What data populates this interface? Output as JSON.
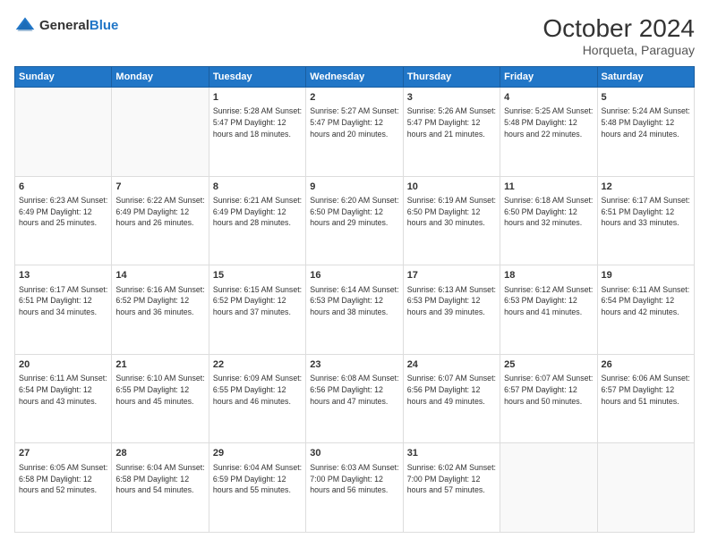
{
  "header": {
    "logo_general": "General",
    "logo_blue": "Blue",
    "month_year": "October 2024",
    "location": "Horqueta, Paraguay"
  },
  "days_of_week": [
    "Sunday",
    "Monday",
    "Tuesday",
    "Wednesday",
    "Thursday",
    "Friday",
    "Saturday"
  ],
  "weeks": [
    [
      {
        "day": "",
        "info": ""
      },
      {
        "day": "",
        "info": ""
      },
      {
        "day": "1",
        "info": "Sunrise: 5:28 AM\nSunset: 5:47 PM\nDaylight: 12 hours and 18 minutes."
      },
      {
        "day": "2",
        "info": "Sunrise: 5:27 AM\nSunset: 5:47 PM\nDaylight: 12 hours and 20 minutes."
      },
      {
        "day": "3",
        "info": "Sunrise: 5:26 AM\nSunset: 5:47 PM\nDaylight: 12 hours and 21 minutes."
      },
      {
        "day": "4",
        "info": "Sunrise: 5:25 AM\nSunset: 5:48 PM\nDaylight: 12 hours and 22 minutes."
      },
      {
        "day": "5",
        "info": "Sunrise: 5:24 AM\nSunset: 5:48 PM\nDaylight: 12 hours and 24 minutes."
      }
    ],
    [
      {
        "day": "6",
        "info": "Sunrise: 6:23 AM\nSunset: 6:49 PM\nDaylight: 12 hours and 25 minutes."
      },
      {
        "day": "7",
        "info": "Sunrise: 6:22 AM\nSunset: 6:49 PM\nDaylight: 12 hours and 26 minutes."
      },
      {
        "day": "8",
        "info": "Sunrise: 6:21 AM\nSunset: 6:49 PM\nDaylight: 12 hours and 28 minutes."
      },
      {
        "day": "9",
        "info": "Sunrise: 6:20 AM\nSunset: 6:50 PM\nDaylight: 12 hours and 29 minutes."
      },
      {
        "day": "10",
        "info": "Sunrise: 6:19 AM\nSunset: 6:50 PM\nDaylight: 12 hours and 30 minutes."
      },
      {
        "day": "11",
        "info": "Sunrise: 6:18 AM\nSunset: 6:50 PM\nDaylight: 12 hours and 32 minutes."
      },
      {
        "day": "12",
        "info": "Sunrise: 6:17 AM\nSunset: 6:51 PM\nDaylight: 12 hours and 33 minutes."
      }
    ],
    [
      {
        "day": "13",
        "info": "Sunrise: 6:17 AM\nSunset: 6:51 PM\nDaylight: 12 hours and 34 minutes."
      },
      {
        "day": "14",
        "info": "Sunrise: 6:16 AM\nSunset: 6:52 PM\nDaylight: 12 hours and 36 minutes."
      },
      {
        "day": "15",
        "info": "Sunrise: 6:15 AM\nSunset: 6:52 PM\nDaylight: 12 hours and 37 minutes."
      },
      {
        "day": "16",
        "info": "Sunrise: 6:14 AM\nSunset: 6:53 PM\nDaylight: 12 hours and 38 minutes."
      },
      {
        "day": "17",
        "info": "Sunrise: 6:13 AM\nSunset: 6:53 PM\nDaylight: 12 hours and 39 minutes."
      },
      {
        "day": "18",
        "info": "Sunrise: 6:12 AM\nSunset: 6:53 PM\nDaylight: 12 hours and 41 minutes."
      },
      {
        "day": "19",
        "info": "Sunrise: 6:11 AM\nSunset: 6:54 PM\nDaylight: 12 hours and 42 minutes."
      }
    ],
    [
      {
        "day": "20",
        "info": "Sunrise: 6:11 AM\nSunset: 6:54 PM\nDaylight: 12 hours and 43 minutes."
      },
      {
        "day": "21",
        "info": "Sunrise: 6:10 AM\nSunset: 6:55 PM\nDaylight: 12 hours and 45 minutes."
      },
      {
        "day": "22",
        "info": "Sunrise: 6:09 AM\nSunset: 6:55 PM\nDaylight: 12 hours and 46 minutes."
      },
      {
        "day": "23",
        "info": "Sunrise: 6:08 AM\nSunset: 6:56 PM\nDaylight: 12 hours and 47 minutes."
      },
      {
        "day": "24",
        "info": "Sunrise: 6:07 AM\nSunset: 6:56 PM\nDaylight: 12 hours and 49 minutes."
      },
      {
        "day": "25",
        "info": "Sunrise: 6:07 AM\nSunset: 6:57 PM\nDaylight: 12 hours and 50 minutes."
      },
      {
        "day": "26",
        "info": "Sunrise: 6:06 AM\nSunset: 6:57 PM\nDaylight: 12 hours and 51 minutes."
      }
    ],
    [
      {
        "day": "27",
        "info": "Sunrise: 6:05 AM\nSunset: 6:58 PM\nDaylight: 12 hours and 52 minutes."
      },
      {
        "day": "28",
        "info": "Sunrise: 6:04 AM\nSunset: 6:58 PM\nDaylight: 12 hours and 54 minutes."
      },
      {
        "day": "29",
        "info": "Sunrise: 6:04 AM\nSunset: 6:59 PM\nDaylight: 12 hours and 55 minutes."
      },
      {
        "day": "30",
        "info": "Sunrise: 6:03 AM\nSunset: 7:00 PM\nDaylight: 12 hours and 56 minutes."
      },
      {
        "day": "31",
        "info": "Sunrise: 6:02 AM\nSunset: 7:00 PM\nDaylight: 12 hours and 57 minutes."
      },
      {
        "day": "",
        "info": ""
      },
      {
        "day": "",
        "info": ""
      }
    ]
  ]
}
